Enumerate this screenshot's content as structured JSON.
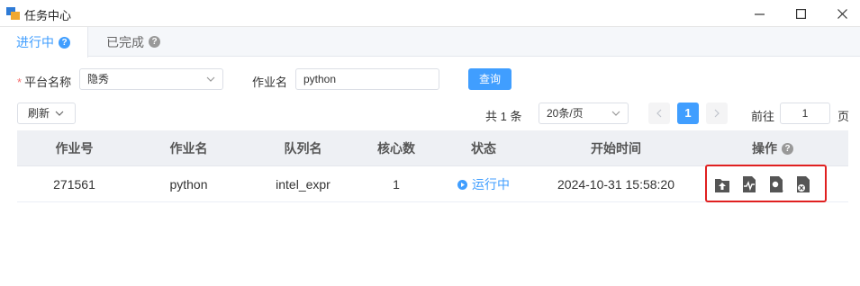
{
  "window": {
    "title": "任务中心"
  },
  "tabs": [
    {
      "label": "进行中",
      "active": true
    },
    {
      "label": "已完成",
      "active": false
    }
  ],
  "filters": {
    "platform_label": "平台名称",
    "platform_value": "隐秀",
    "job_label": "作业名",
    "job_value": "python",
    "query_label": "查询"
  },
  "toolbar": {
    "refresh_label": "刷新",
    "total": "共 1 条",
    "page_size": "20条/页",
    "current_page": "1",
    "goto_label": "前往",
    "goto_value": "1",
    "page_suffix": "页"
  },
  "table": {
    "columns": [
      "作业号",
      "作业名",
      "队列名",
      "核心数",
      "状态",
      "开始时间",
      "操作"
    ],
    "rows": [
      {
        "job_id": "271561",
        "job_name": "python",
        "queue": "intel_expr",
        "cores": "1",
        "status": "运行中",
        "start_time": "2024-10-31 15:58:20"
      }
    ],
    "actions": [
      "upload-icon",
      "monitor-icon",
      "inspect-icon",
      "cancel-icon"
    ]
  },
  "colors": {
    "accent": "#409eff",
    "highlight": "#e02020"
  }
}
